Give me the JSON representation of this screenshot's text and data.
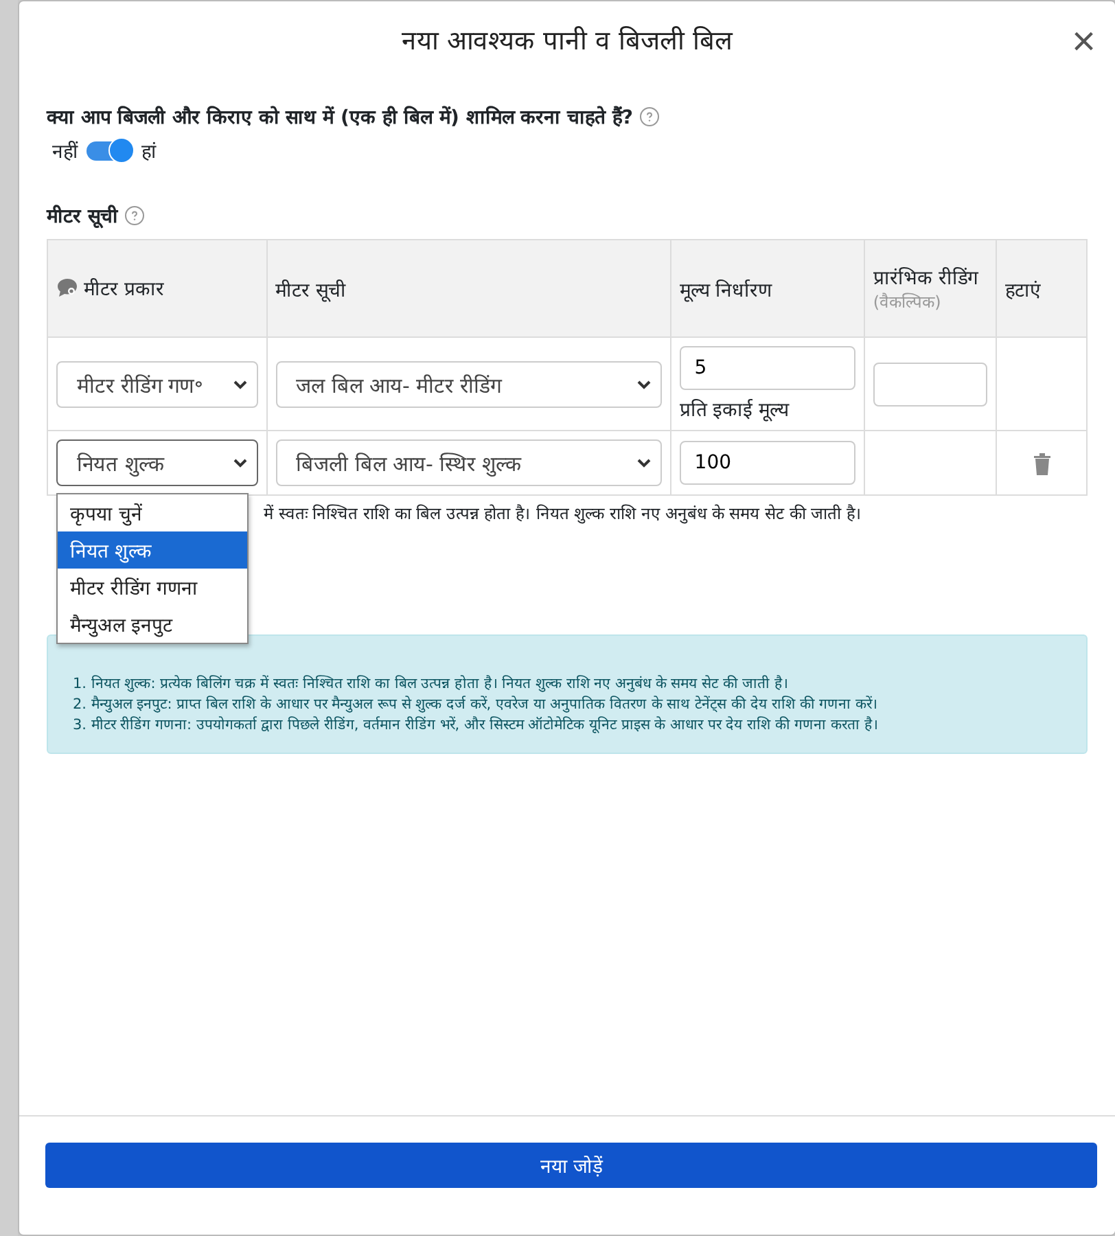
{
  "dialog": {
    "title": "नया आवश्यक पानी व बिजली बिल",
    "close": "×"
  },
  "combine": {
    "question": "क्या आप बिजली और किराए को साथ में (एक ही बिल में) शामिल करना चाहते हैं?",
    "off_label": "नहीं",
    "on_label": "हां",
    "on": true
  },
  "meters": {
    "title": "मीटर सूची",
    "columns": [
      {
        "label": "मीटर प्रकार",
        "icon": true
      },
      {
        "label": "मीटर सूची"
      },
      {
        "label": "मूल्य निर्धारण"
      },
      {
        "label": "प्रारंभिक रीडिंग",
        "note": "(वैकल्पिक)"
      },
      {
        "label": "हटाएं"
      }
    ],
    "rows": [
      {
        "meter_type": "मीटर रीडिंग गण॰",
        "meter_list": "जल बिल आय- मीटर रीडिंग",
        "price": "5",
        "price_hint": "प्रति इकाई मूल्य",
        "has_reading": true,
        "deletable": false,
        "open": false
      },
      {
        "meter_type": "नियत शुल्क",
        "meter_list": "बिजली बिल आय- स्थिर शुल्क",
        "price": "100",
        "has_reading": false,
        "deletable": true,
        "open": true,
        "options": [
          {
            "label": "कृपया चुनें",
            "selected": false
          },
          {
            "label": "नियत शुल्क",
            "selected": true
          },
          {
            "label": "मीटर रीडिंग गणना",
            "selected": false
          },
          {
            "label": "मैन्युअल इनपुट",
            "selected": false
          }
        ]
      }
    ],
    "hint": "में स्वतः निश्चित राशि का बिल उत्पन्न होता है। नियत शुल्क राशि नए अनुबंध के समय सेट की जाती है।"
  },
  "info": [
    "1. नियत शुल्क: प्रत्येक बिलिंग चक्र में स्वतः निश्चित राशि का बिल उत्पन्न होता है। नियत शुल्क राशि नए अनुबंध के समय सेट की जाती है।",
    "2. मैन्युअल इनपुट: प्राप्त बिल राशि के आधार पर मैन्युअल रूप से शुल्क दर्ज करें, एवरेज या अनुपातिक वितरण के साथ टेनेंट्स की देय राशि की गणना करें।",
    "3. मीटर रीडिंग गणना: उपयोगकर्ता द्वारा पिछले रीडिंग, वर्तमान रीडिंग भरें, और सिस्टम ऑटोमेटिक यूनिट प्राइस के आधार पर देय राशि की गणना करता है।"
  ],
  "add_button": "नया जोड़ें"
}
